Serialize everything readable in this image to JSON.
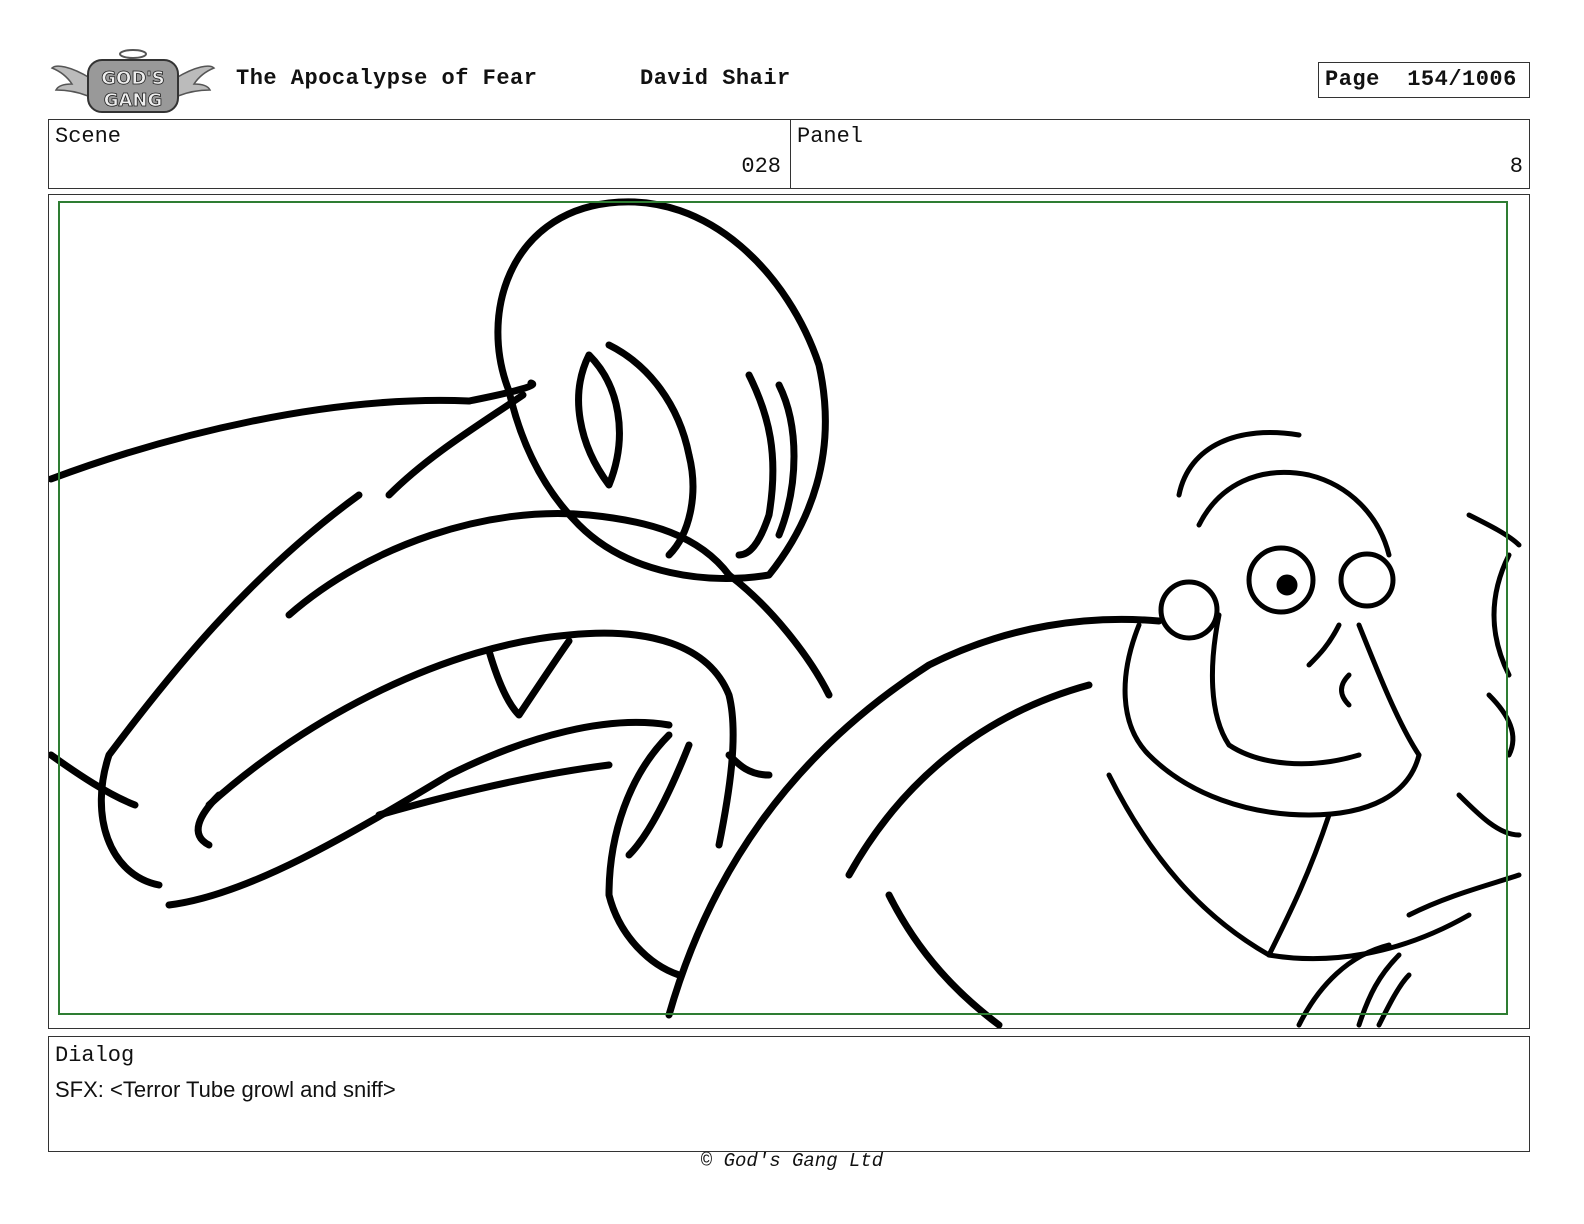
{
  "header": {
    "logo_text": "GOD'S GANG",
    "title": "The Apocalypse of Fear",
    "author": "David Shair",
    "page_label": "Page",
    "page_value": "154/1006"
  },
  "info": {
    "scene_label": "Scene",
    "scene_value": "028",
    "panel_label": "Panel",
    "panel_value": "8"
  },
  "dialog": {
    "label": "Dialog",
    "text": "SFX: <Terror Tube growl and sniff>"
  },
  "footer": {
    "copyright": "© God's Gang Ltd"
  },
  "colors": {
    "safe_frame": "#2e7d32",
    "ink": "#000000",
    "border": "#333333"
  }
}
